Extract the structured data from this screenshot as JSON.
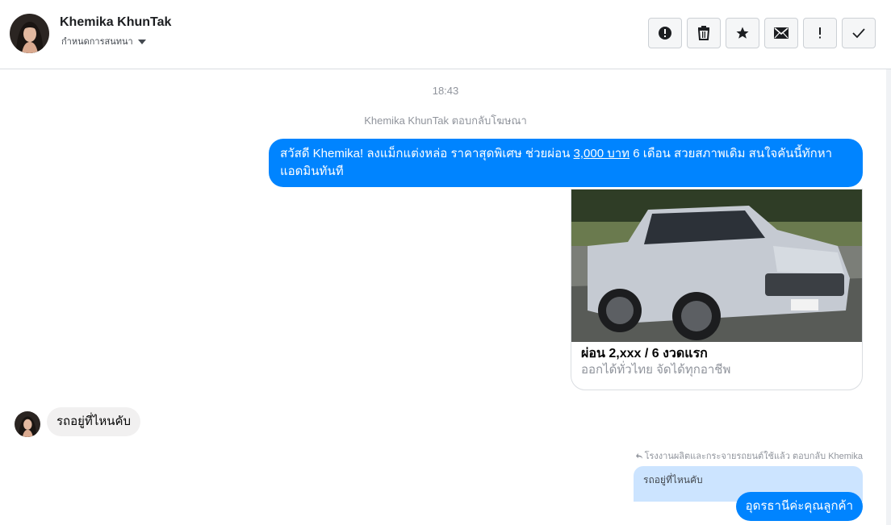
{
  "header": {
    "contact_name": "Khemika KhunTak",
    "assign_label": "กำหนดการสนทนา"
  },
  "toolbar": {
    "buttons": [
      {
        "name": "spam",
        "icon": "alert-circle-icon"
      },
      {
        "name": "delete",
        "icon": "trash-icon"
      },
      {
        "name": "star",
        "icon": "star-icon"
      },
      {
        "name": "mark-unread",
        "icon": "envelope-icon"
      },
      {
        "name": "follow-up",
        "icon": "exclamation-icon"
      },
      {
        "name": "done",
        "icon": "checkmark-icon"
      }
    ]
  },
  "thread": {
    "timestamp": "18:43",
    "reply_note": "Khemika KhunTak ตอบกลับโฆษณา",
    "outgoing_message": {
      "before": "สวัสดี Khemika! ลงแม็กแต่งหล่อ ราคาสุดพิเศษ ช่วยผ่อน ",
      "highlight": "3,000 บาท",
      "after": " 6 เดือน สวยสภาพเดิม สนใจคันนี้ทักหาแอดมินทันที"
    },
    "ad_card": {
      "title": "ผ่อน 2,xxx / 6 งวดแรก",
      "subtitle": "ออกได้ทั่วไทย จัดได้ทุกอาชีพ"
    },
    "incoming_message": "รถอยู่ที่ไหนคับ",
    "quote_note": "โรงงานผลิตและกระจายรถยนต์ใช้แล้ว ตอบกลับ Khemika",
    "quoted_text": "รถอยู่ที่ไหนคับ",
    "reply_message": "อุดรธานีค่ะคุณลูกค้า"
  },
  "colors": {
    "messenger_blue": "#0084ff",
    "incoming_bubble": "#f1f0f0",
    "quote_bubble": "#cce4ff"
  }
}
